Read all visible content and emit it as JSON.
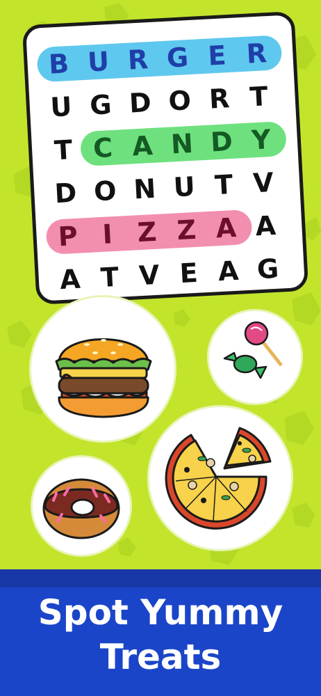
{
  "grid": {
    "rows": [
      [
        "B",
        "U",
        "R",
        "G",
        "E",
        "R"
      ],
      [
        "U",
        "G",
        "D",
        "O",
        "R",
        "T"
      ],
      [
        "T",
        "C",
        "A",
        "N",
        "D",
        "Y"
      ],
      [
        "D",
        "O",
        "N",
        "U",
        "T",
        "V"
      ],
      [
        "P",
        "I",
        "Z",
        "Z",
        "A",
        "A"
      ],
      [
        "A",
        "T",
        "V",
        "E",
        "A",
        "G"
      ]
    ],
    "found_words": [
      {
        "word": "BURGER",
        "color": "#5fc8ef"
      },
      {
        "word": "CANDY",
        "color": "#6ee17e"
      },
      {
        "word": "PIZZA",
        "color": "#f28fae"
      }
    ]
  },
  "foods": [
    {
      "name": "burger",
      "icon": "burger-icon"
    },
    {
      "name": "candy",
      "icon": "candy-icon"
    },
    {
      "name": "donut",
      "icon": "donut-icon"
    },
    {
      "name": "pizza",
      "icon": "pizza-icon"
    }
  ],
  "tagline": {
    "line1": "Spot Yummy",
    "line2": "Treats"
  },
  "colors": {
    "background": "#c2e52c",
    "footer": "#1b45c9",
    "highlight_blue": "#5fc8ef",
    "highlight_green": "#6ee17e",
    "highlight_pink": "#f28fae"
  }
}
